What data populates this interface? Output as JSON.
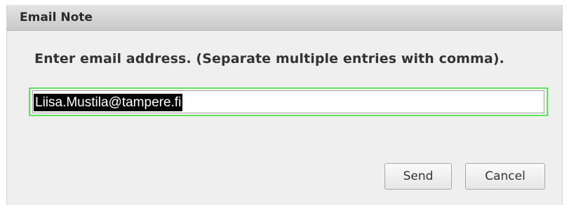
{
  "dialog": {
    "title": "Email Note",
    "instruction": "Enter email address. (Separate multiple entries with comma).",
    "email": {
      "value": "Liisa.Mustila@tampere.fi",
      "focused": true,
      "text_selected": true,
      "focus_color": "#5ee35c"
    },
    "buttons": {
      "send_label": "Send",
      "cancel_label": "Cancel"
    }
  }
}
